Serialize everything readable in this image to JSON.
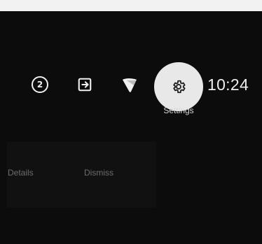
{
  "status_bar": {
    "notification_count": "2",
    "icons": [
      "notification-count-icon",
      "input-icon",
      "wifi-icon",
      "settings-icon"
    ],
    "time": "10:24",
    "tooltip": "Settings",
    "settings_selected": true
  },
  "toast": {
    "details_label": "Details",
    "dismiss_label": "Dismiss"
  },
  "colors": {
    "background": "#0c0c0d",
    "focus": "#e8e8e8",
    "text": "#ededed",
    "muted_text": "#6d6d6f"
  }
}
